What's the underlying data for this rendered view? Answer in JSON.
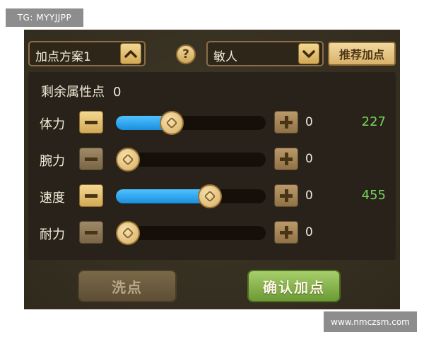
{
  "watermarks": {
    "top_left": "TG: MYYJJPP",
    "bottom_right": "www.nmczsm.com"
  },
  "header": {
    "plan_dropdown": {
      "value": "加点方案1",
      "icon": "chevron-up-icon"
    },
    "help_label": "?",
    "preset_dropdown": {
      "value": "敏人",
      "icon": "chevron-down-icon"
    },
    "recommend_label": "推荐加点"
  },
  "remaining": {
    "label": "剩余属性点",
    "value": "0"
  },
  "stats": [
    {
      "name": "体力",
      "added": "0",
      "total": "227",
      "slider_fraction": 0.35,
      "minus_enabled": true
    },
    {
      "name": "腕力",
      "added": "0",
      "total": "",
      "slider_fraction": 0.0,
      "minus_enabled": false
    },
    {
      "name": "速度",
      "added": "0",
      "total": "455",
      "slider_fraction": 0.65,
      "minus_enabled": true
    },
    {
      "name": "耐力",
      "added": "0",
      "total": "",
      "slider_fraction": 0.0,
      "minus_enabled": false
    }
  ],
  "buttons": {
    "reset_label": "洗点",
    "confirm_label": "确认加点"
  },
  "colors": {
    "slider_fill": "#29a6f0",
    "total_value": "#76d65a",
    "confirm_button": "#8bb850"
  }
}
